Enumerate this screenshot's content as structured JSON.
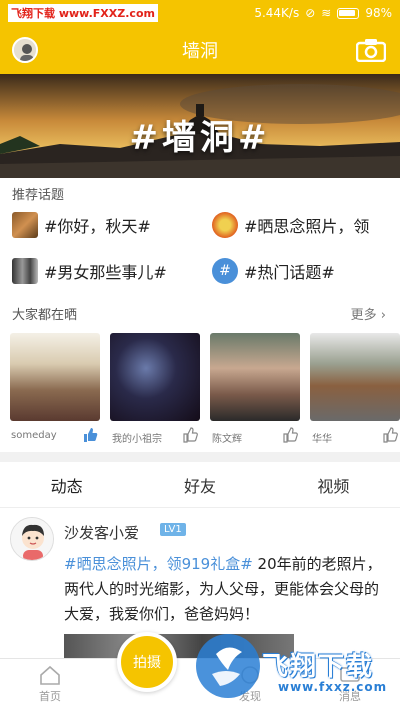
{
  "status_bar": {
    "watermark": "飞翔下载 www.FXXZ.com",
    "network_speed": "5.44K/s",
    "battery": "98%"
  },
  "header": {
    "title": "墙洞"
  },
  "banner": {
    "text": "#墙洞#"
  },
  "recommended": {
    "label": "推荐话题",
    "topics": [
      {
        "label": "#你好，秋天#"
      },
      {
        "label": "#晒思念照片，领"
      },
      {
        "label": "#男女那些事儿#"
      },
      {
        "label": "#热门话题#"
      }
    ]
  },
  "everyone": {
    "label": "大家都在晒",
    "more": "更多",
    "photos": [
      {
        "user": "someday"
      },
      {
        "user": "我的小祖宗"
      },
      {
        "user": "陈文辉"
      },
      {
        "user": "华华"
      }
    ]
  },
  "tabs": [
    {
      "label": "动态"
    },
    {
      "label": "好友"
    },
    {
      "label": "视频"
    }
  ],
  "post": {
    "user": "沙发客小爱",
    "level": "LV1",
    "tag": "#晒思念照片，领919礼盒#",
    "text": " 20年前的老照片，两代人的时光缩影，为人父母，更能体会父母的大爱，我爱你们，爸爸妈妈！"
  },
  "bottom_nav": {
    "home": "首页",
    "shoot": "拍摄",
    "discover": "发现",
    "messages": "消息"
  },
  "logo_watermark": {
    "text": "飞翔下载",
    "url": "www.fxxz.com"
  },
  "colors": {
    "brand_yellow": "#f5c400",
    "link_blue": "#4a90d9",
    "level_blue": "#6fb3e8"
  }
}
